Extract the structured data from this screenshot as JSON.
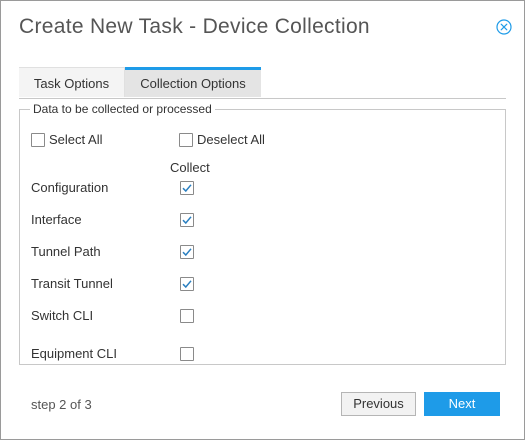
{
  "dialog": {
    "title": "Create New Task - Device Collection",
    "close_icon": "close-circle-icon"
  },
  "tabs": [
    {
      "label": "Task Options",
      "active": false
    },
    {
      "label": "Collection Options",
      "active": true
    }
  ],
  "fieldset": {
    "legend": "Data to be collected or processed",
    "select_all": {
      "label": "Select All",
      "checked": false
    },
    "deselect_all": {
      "label": "Deselect All",
      "checked": false
    },
    "column_header": "Collect",
    "rows": [
      {
        "label": "Configuration",
        "checked": true
      },
      {
        "label": "Interface",
        "checked": true
      },
      {
        "label": "Tunnel Path",
        "checked": true
      },
      {
        "label": "Transit Tunnel",
        "checked": true
      },
      {
        "label": "Switch CLI",
        "checked": false
      },
      {
        "label": "Equipment CLI",
        "checked": false
      }
    ]
  },
  "footer": {
    "step_text": "step 2 of 3",
    "previous_label": "Previous",
    "next_label": "Next"
  },
  "colors": {
    "accent": "#1e9be8",
    "check": "#2a7fc0"
  }
}
